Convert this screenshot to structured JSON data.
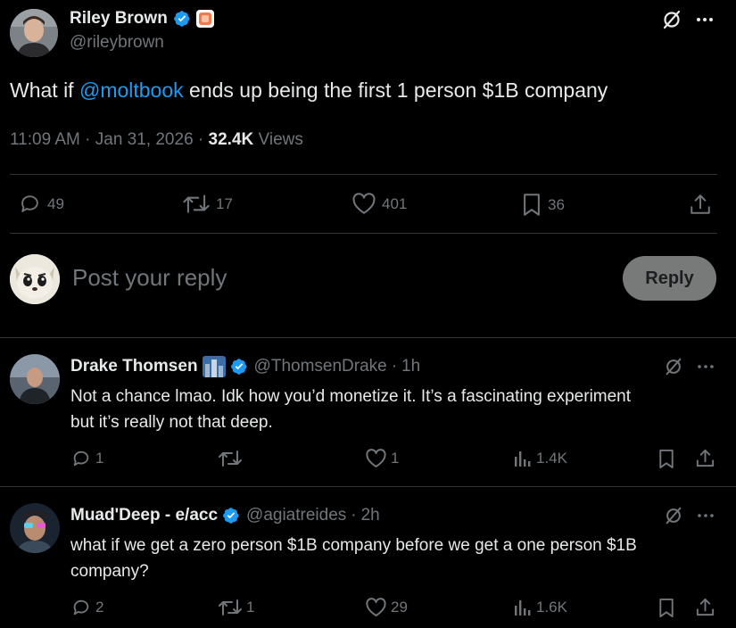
{
  "tweet": {
    "author_name": "Riley Brown",
    "author_handle": "@rileybrown",
    "text_before": "What if ",
    "mention": "@moltbook",
    "text_after": " ends up being the first 1 person $1B company",
    "time": "11:09 AM",
    "sep1": " · ",
    "date": "Jan 31, 2026",
    "sep2": " · ",
    "views_count": "32.4K",
    "views_label": " Views",
    "replies": "49",
    "reposts": "17",
    "likes": "401",
    "bookmarks": "36"
  },
  "composer": {
    "placeholder": "Post your reply",
    "reply_button": "Reply"
  },
  "replies": [
    {
      "name": "Drake Thomsen",
      "handle": "@ThomsenDrake",
      "dot": "·",
      "time": "1h",
      "text_line1": "Not a chance lmao. Idk how you’d monetize it. It’s a fascinating experiment",
      "text_line2": "but it’s really not that deep.",
      "replies": "1",
      "reposts": "",
      "likes": "1",
      "views": "1.4K"
    },
    {
      "name": "Muad'Deep - e/acc",
      "handle": "@agiatreides",
      "dot": "·",
      "time": "2h",
      "text_line1": "what if we get a zero person $1B company before we get a one person $1B",
      "text_line2": "company?",
      "replies": "2",
      "reposts": "1",
      "likes": "29",
      "views": "1.6K"
    }
  ],
  "colors": {
    "background": "#000000",
    "text": "#e7e9ea",
    "muted": "#71767b",
    "link": "#1d9bf0",
    "divider": "#2f3336",
    "reply_button_bg": "#787a7a"
  },
  "icons": [
    "verified-badge-icon",
    "grok-icon",
    "more-icon",
    "reply-icon",
    "repost-icon",
    "like-icon",
    "bookmark-icon",
    "share-icon",
    "views-icon"
  ]
}
